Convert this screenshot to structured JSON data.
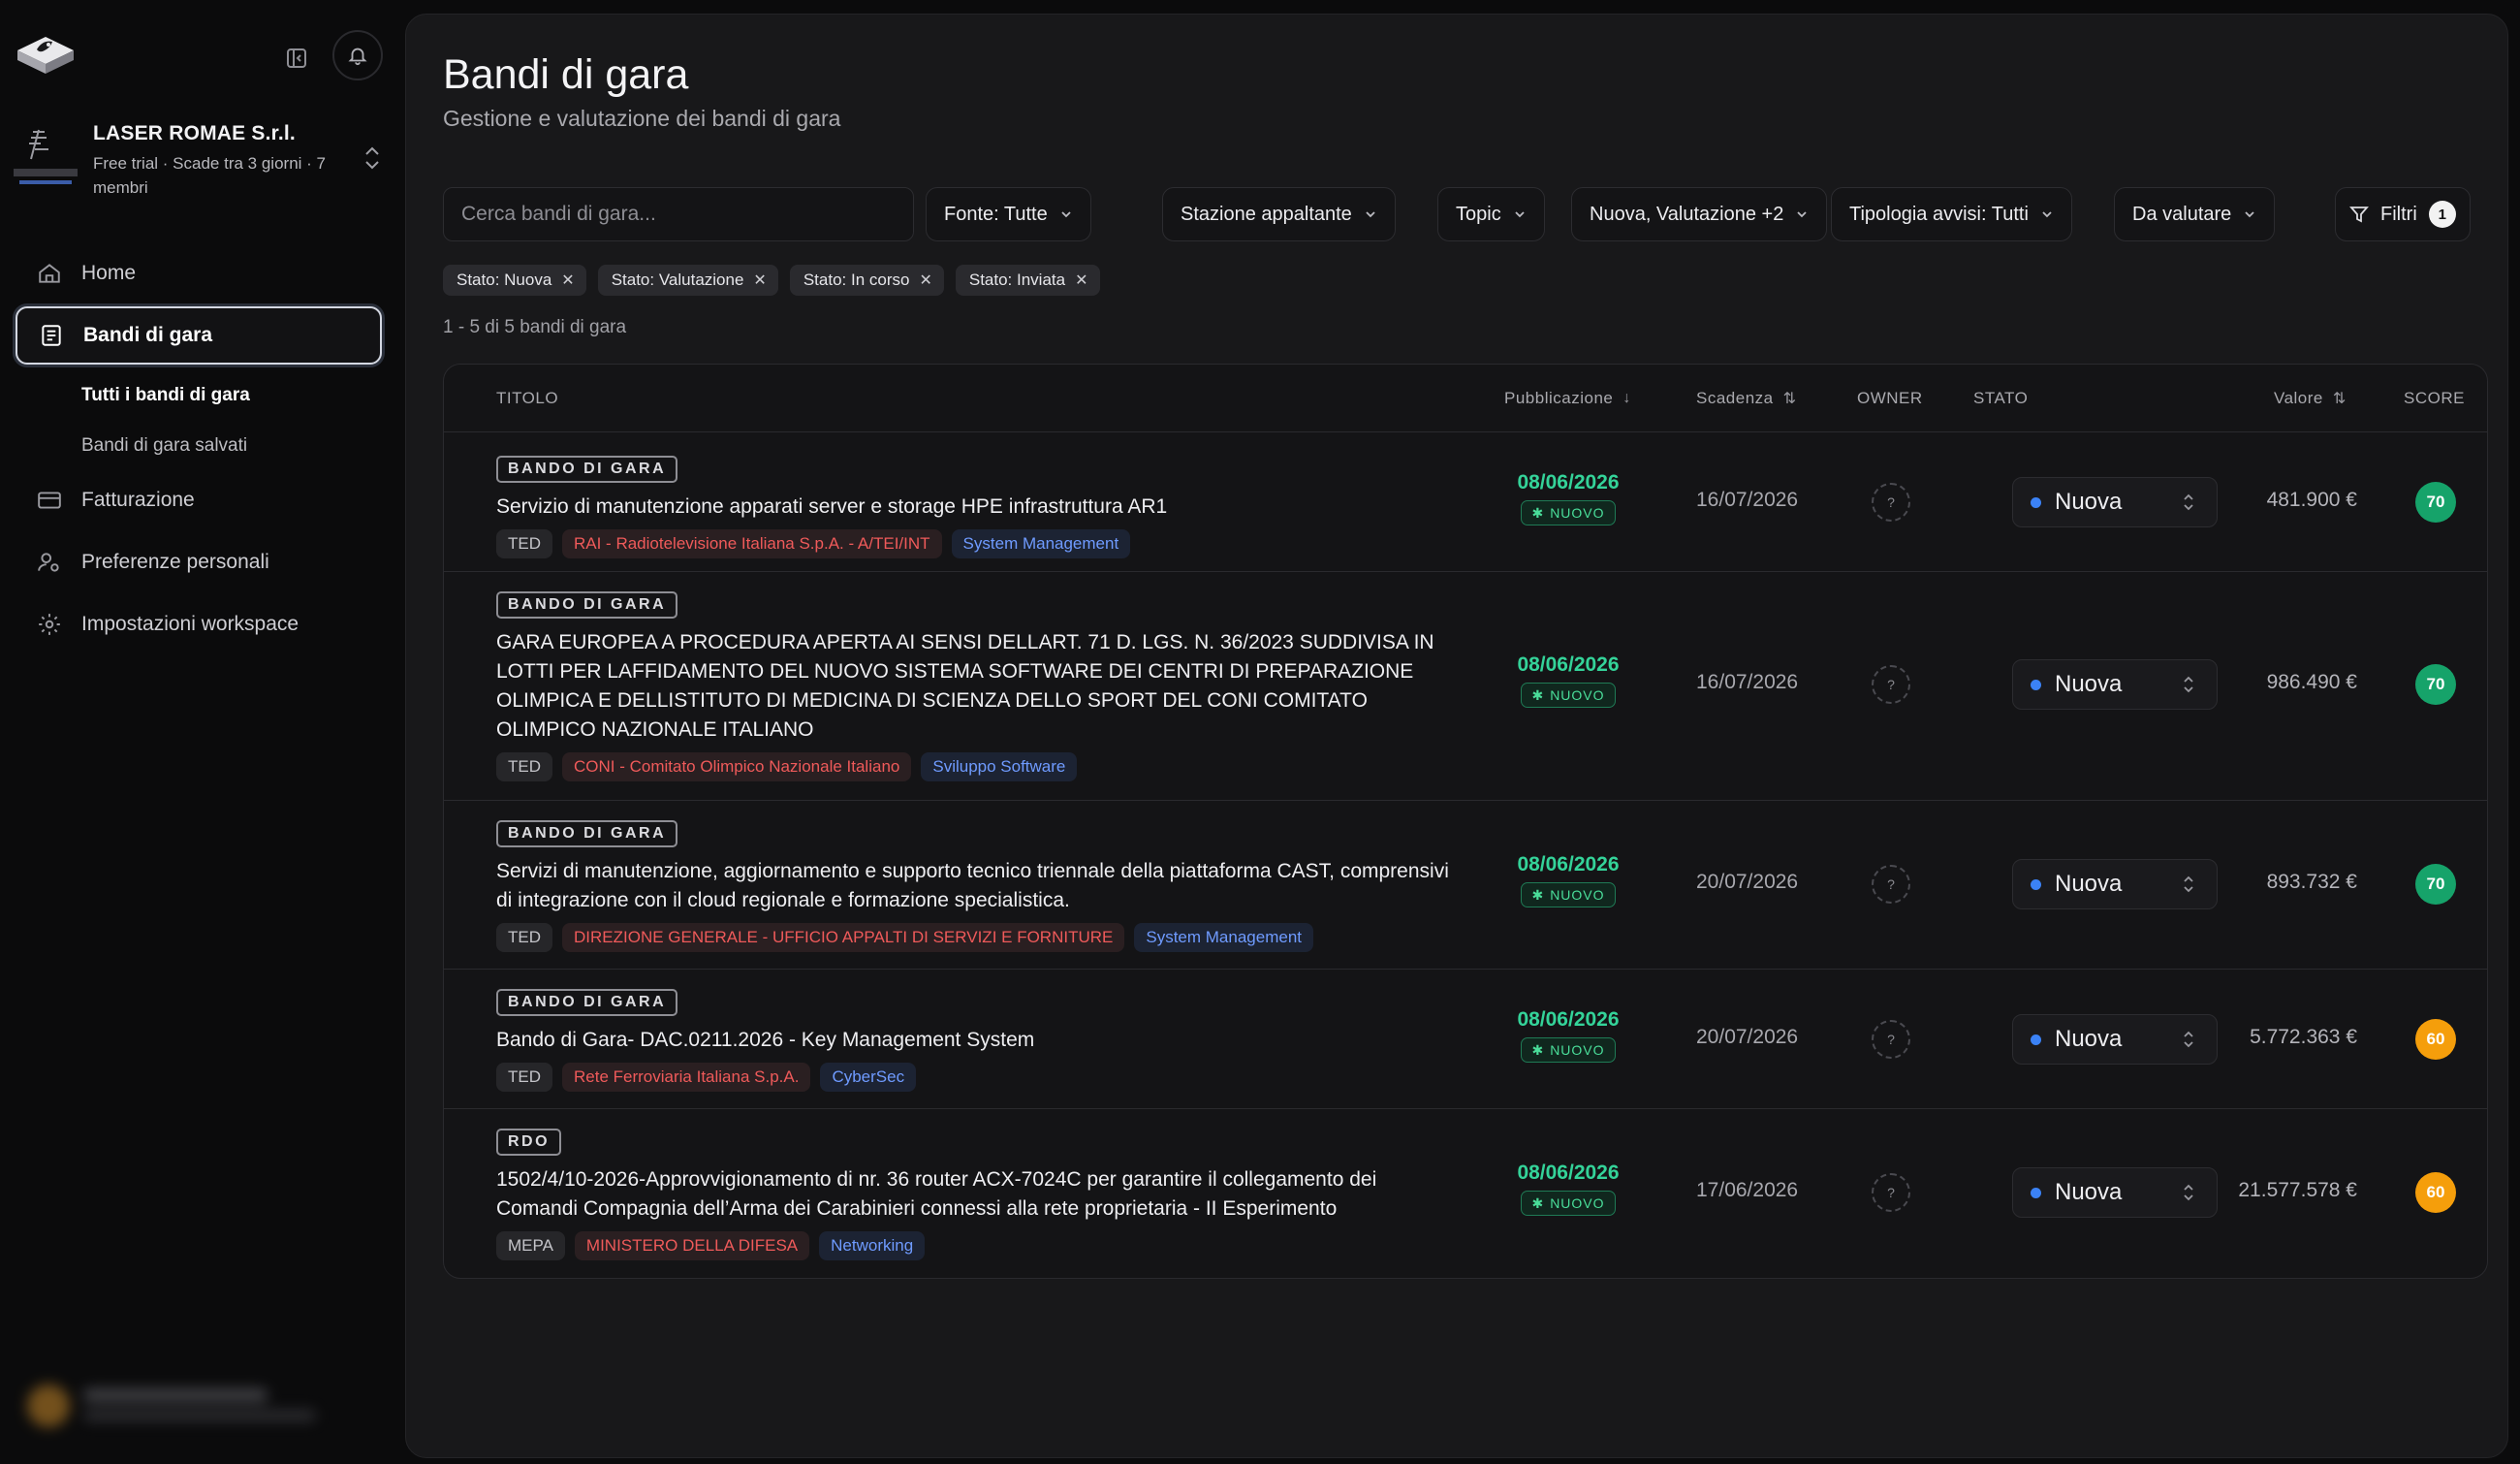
{
  "sidebar": {
    "workspace": {
      "name": "LASER ROMAE S.r.l.",
      "subtitle": "Free trial · Scade tra 3 giorni · 7 membri"
    },
    "nav": {
      "home": "Home",
      "bandi": "Bandi di gara",
      "tutti": "Tutti i bandi di gara",
      "salvati": "Bandi di gara salvati",
      "fatturazione": "Fatturazione",
      "preferenze": "Preferenze personali",
      "impostazioni": "Impostazioni workspace"
    }
  },
  "header": {
    "title": "Bandi di gara",
    "subtitle": "Gestione e valutazione dei bandi di gara"
  },
  "search": {
    "placeholder": "Cerca bandi di gara..."
  },
  "filters": {
    "fonte": "Fonte: Tutte",
    "stazione": "Stazione appaltante",
    "topic": "Topic",
    "stato": "Nuova, Valutazione +2",
    "tipologia": "Tipologia avvisi: Tutti",
    "valutare": "Da valutare",
    "filtri": "Filtri",
    "filtri_count": "1"
  },
  "chips": [
    {
      "label": "Stato: Nuova"
    },
    {
      "label": "Stato: Valutazione"
    },
    {
      "label": "Stato: In corso"
    },
    {
      "label": "Stato: Inviata"
    }
  ],
  "result_count": "1 - 5 di 5 bandi di gara",
  "table": {
    "headers": {
      "titolo": "TITOLO",
      "pubblicazione": "Pubblicazione",
      "scadenza": "Scadenza",
      "owner": "OWNER",
      "stato": "STATO",
      "valore": "Valore",
      "score": "SCORE"
    },
    "rows": [
      {
        "type": "BANDO DI GARA",
        "title": "Servizio di manutenzione apparati server e storage HPE infrastruttura AR1",
        "source": "TED",
        "entity": "RAI - Radiotelevisione Italiana S.p.A. - A/TEI/INT",
        "topic": "System Management",
        "pub": "08/06/2026",
        "badge": "NUOVO",
        "scadenza": "16/07/2026",
        "owner": "?",
        "stato": "Nuova",
        "valore": "481.900 €",
        "score": "70",
        "score_color": "#16a36a"
      },
      {
        "type": "BANDO DI GARA",
        "title": "GARA EUROPEA A PROCEDURA APERTA AI SENSI DELLART. 71 D. LGS. N. 36/2023 SUDDIVISA IN LOTTI PER LAFFIDAMENTO DEL NUOVO SISTEMA SOFTWARE DEI CENTRI DI PREPARAZIONE OLIMPICA E DELLISTITUTO DI MEDICINA DI SCIENZA DELLO SPORT DEL CONI COMITATO OLIMPICO NAZIONALE ITALIANO",
        "source": "TED",
        "entity": "CONI - Comitato Olimpico Nazionale Italiano",
        "topic": "Sviluppo Software",
        "pub": "08/06/2026",
        "badge": "NUOVO",
        "scadenza": "16/07/2026",
        "owner": "?",
        "stato": "Nuova",
        "valore": "986.490 €",
        "score": "70",
        "score_color": "#16a36a"
      },
      {
        "type": "BANDO DI GARA",
        "title": "Servizi di manutenzione, aggiornamento e supporto tecnico triennale della piattaforma CAST, comprensivi di integrazione con il cloud regionale e formazione specialistica.",
        "source": "TED",
        "entity": "DIREZIONE GENERALE - UFFICIO APPALTI DI SERVIZI E FORNITURE",
        "topic": "System Management",
        "pub": "08/06/2026",
        "badge": "NUOVO",
        "scadenza": "20/07/2026",
        "owner": "?",
        "stato": "Nuova",
        "valore": "893.732 €",
        "score": "70",
        "score_color": "#16a36a"
      },
      {
        "type": "BANDO DI GARA",
        "title": "Bando di Gara- DAC.0211.2026 - Key Management System",
        "source": "TED",
        "entity": "Rete Ferroviaria Italiana S.p.A.",
        "topic": "CyberSec",
        "pub": "08/06/2026",
        "badge": "NUOVO",
        "scadenza": "20/07/2026",
        "owner": "?",
        "stato": "Nuova",
        "valore": "5.772.363 €",
        "score": "60",
        "score_color": "#f59e0b"
      },
      {
        "type": "RDO",
        "title": "1502/4/10-2026-Approvvigionamento di nr. 36 router ACX-7024C per garantire il collegamento dei Comandi Compagnia dell’Arma dei Carabinieri connessi alla rete proprietaria - II Esperimento",
        "source": "MEPA",
        "entity": "MINISTERO DELLA DIFESA",
        "topic": "Networking",
        "pub": "08/06/2026",
        "badge": "NUOVO",
        "scadenza": "17/06/2026",
        "owner": "?",
        "stato": "Nuova",
        "valore": "21.577.578 €",
        "score": "60",
        "score_color": "#f59e0b"
      }
    ]
  }
}
